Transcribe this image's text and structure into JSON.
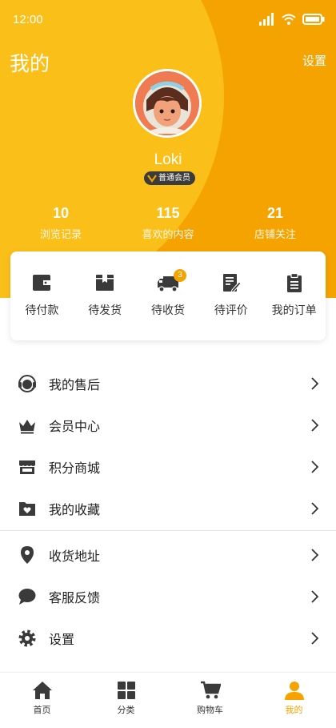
{
  "status_bar": {
    "time": "12:00"
  },
  "header": {
    "title": "我的",
    "settings_label": "设置"
  },
  "profile": {
    "username": "Loki",
    "member_badge": "普通会员"
  },
  "stats": [
    {
      "value": "10",
      "label": "浏览记录"
    },
    {
      "value": "115",
      "label": "喜欢的内容"
    },
    {
      "value": "21",
      "label": "店铺关注"
    }
  ],
  "orders": [
    {
      "label": "待付款",
      "icon": "wallet-icon"
    },
    {
      "label": "待发货",
      "icon": "package-icon"
    },
    {
      "label": "待收货",
      "icon": "truck-icon",
      "badge": "3"
    },
    {
      "label": "待评价",
      "icon": "review-icon"
    },
    {
      "label": "我的订单",
      "icon": "clipboard-icon"
    }
  ],
  "menu_group_1": [
    {
      "label": "我的售后",
      "icon": "headset-icon"
    },
    {
      "label": "会员中心",
      "icon": "crown-icon"
    },
    {
      "label": "积分商城",
      "icon": "store-icon"
    },
    {
      "label": "我的收藏",
      "icon": "favorite-folder-icon"
    }
  ],
  "menu_group_2": [
    {
      "label": "收货地址",
      "icon": "location-pin-icon"
    },
    {
      "label": "客服反馈",
      "icon": "chat-bubble-icon"
    },
    {
      "label": "设置",
      "icon": "gear-icon"
    }
  ],
  "tabbar": [
    {
      "label": "首页",
      "icon": "home-icon",
      "active": false
    },
    {
      "label": "分类",
      "icon": "grid-icon",
      "active": false
    },
    {
      "label": "购物车",
      "icon": "cart-icon",
      "active": false
    },
    {
      "label": "我的",
      "icon": "person-icon",
      "active": true
    }
  ],
  "colors": {
    "accent": "#f5a300",
    "header_light": "#fbbf1a",
    "icon_dark": "#3a3a3a"
  }
}
